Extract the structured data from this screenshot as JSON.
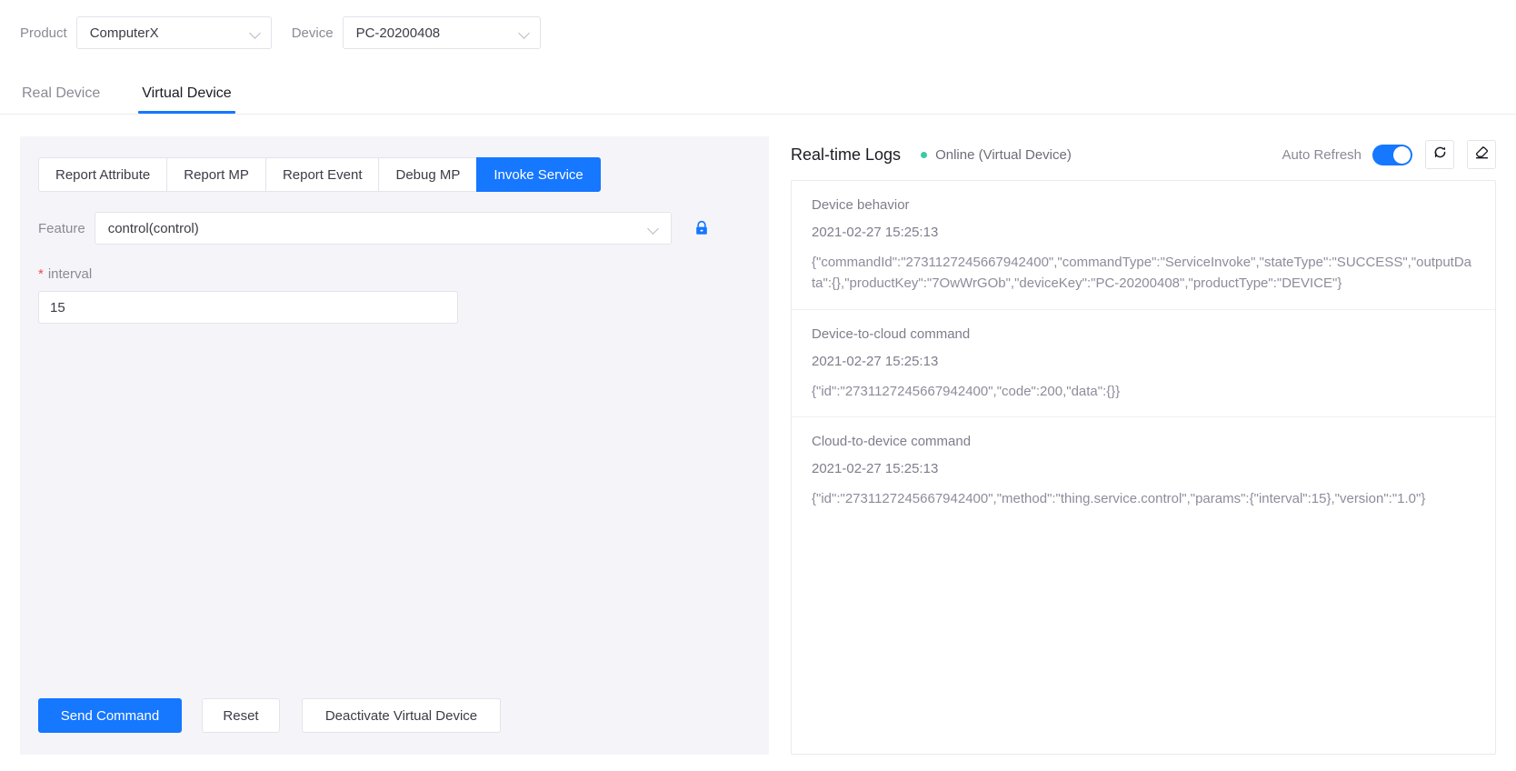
{
  "topbar": {
    "product_label": "Product",
    "product_value": "ComputerX",
    "device_label": "Device",
    "device_value": "PC-20200408"
  },
  "main_tabs": [
    {
      "label": "Real Device",
      "active": false
    },
    {
      "label": "Virtual Device",
      "active": true
    }
  ],
  "debug_panel": {
    "sub_tabs": [
      {
        "label": "Report Attribute",
        "active": false
      },
      {
        "label": "Report MP",
        "active": false
      },
      {
        "label": "Report Event",
        "active": false
      },
      {
        "label": "Debug MP",
        "active": false
      },
      {
        "label": "Invoke Service",
        "active": true
      }
    ],
    "feature_label": "Feature",
    "feature_value": "control(control)",
    "lock_icon": "lock-icon",
    "param": {
      "required_marker": "*",
      "name": "interval",
      "value": "15"
    },
    "buttons": {
      "send": "Send Command",
      "reset": "Reset",
      "deactivate": "Deactivate Virtual Device"
    }
  },
  "logs_panel": {
    "title": "Real-time Logs",
    "status": "Online (Virtual Device)",
    "status_color": "#3ac9a9",
    "auto_refresh_label": "Auto Refresh",
    "auto_refresh_on": true,
    "refresh_icon": "refresh-icon",
    "clear_icon": "eraser-icon",
    "entries": [
      {
        "type": "Device behavior",
        "time": "2021-02-27 15:25:13",
        "payload": "{\"commandId\":\"2731127245667942400\",\"commandType\":\"ServiceInvoke\",\"stateType\":\"SUCCESS\",\"outputData\":{},\"productKey\":\"7OwWrGOb\",\"deviceKey\":\"PC-20200408\",\"productType\":\"DEVICE\"}"
      },
      {
        "type": "Device-to-cloud command",
        "time": "2021-02-27 15:25:13",
        "payload": "{\"id\":\"2731127245667942400\",\"code\":200,\"data\":{}}"
      },
      {
        "type": "Cloud-to-device command",
        "time": "2021-02-27 15:25:13",
        "payload": "{\"id\":\"2731127245667942400\",\"method\":\"thing.service.control\",\"params\":{\"interval\":15},\"version\":\"1.0\"}"
      }
    ]
  },
  "colors": {
    "accent": "#1677ff",
    "panel_bg": "#f5f5f9",
    "online": "#3ac9a9",
    "required": "#f04b4b"
  }
}
